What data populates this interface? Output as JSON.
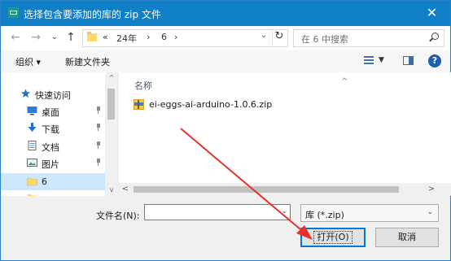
{
  "window": {
    "title": "选择包含要添加的库的 zip 文件",
    "close_glyph": "✕"
  },
  "address_bar": {
    "breadcrumbs": [
      "«",
      "24年",
      "›",
      "6",
      "›"
    ],
    "dropdown_glyph": "⌄",
    "refresh_glyph": "↻"
  },
  "search": {
    "placeholder": "在 6 中搜索"
  },
  "nav_buttons": {
    "back": "←",
    "forward": "→",
    "recent": "⌄",
    "up": "↑"
  },
  "toolbar": {
    "organize": "组织 ▾",
    "new_folder": "新建文件夹",
    "view_dd": "▼",
    "help": "?"
  },
  "sidebar": {
    "items": [
      {
        "label": "快速访问",
        "icon": "star-icon",
        "pinned": false,
        "selected": false
      },
      {
        "label": "桌面",
        "icon": "desktop-icon",
        "pinned": true,
        "selected": false
      },
      {
        "label": "下载",
        "icon": "download-icon",
        "pinned": true,
        "selected": false
      },
      {
        "label": "文档",
        "icon": "document-icon",
        "pinned": true,
        "selected": false
      },
      {
        "label": "图片",
        "icon": "picture-icon",
        "pinned": true,
        "selected": false
      },
      {
        "label": "6",
        "icon": "folder-icon",
        "pinned": false,
        "selected": true
      }
    ]
  },
  "file_list": {
    "column_header": "名称",
    "sort_glyph": "^",
    "files": [
      {
        "name": "ei-eggs-ai-arduino-1.0.6.zip",
        "icon": "zip-icon"
      }
    ]
  },
  "scroll": {
    "up": "^",
    "down": "v",
    "left": "<",
    "right": ">"
  },
  "bottom": {
    "filename_label": "文件名(N):",
    "filename_value": "",
    "filetype_value": "库 (*.zip)",
    "open_label": "打开(O)",
    "cancel_label": "取消"
  },
  "colors": {
    "title_bar": "#0f7fc8",
    "accent": "#0078d7",
    "annotation_arrow": "#e8312a"
  }
}
